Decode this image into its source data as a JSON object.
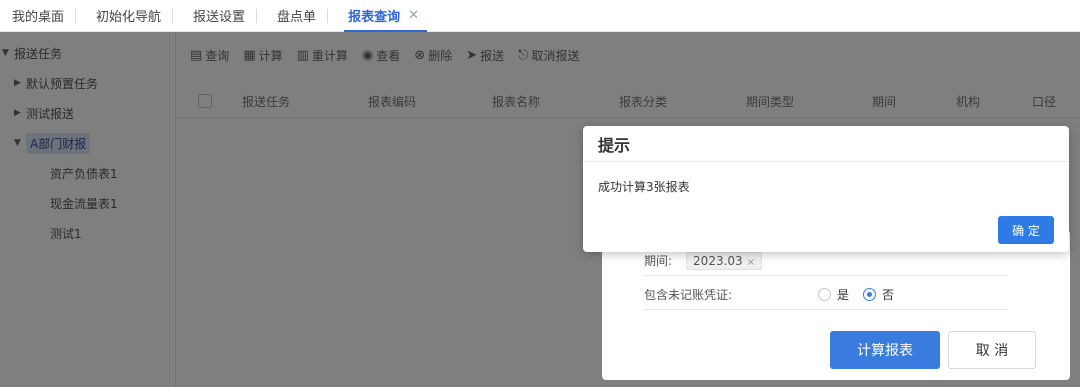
{
  "tabs": [
    {
      "label": "我的桌面"
    },
    {
      "label": "初始化导航"
    },
    {
      "label": "报送设置"
    },
    {
      "label": "盘点单"
    },
    {
      "label": "报表查询",
      "active": true,
      "close": "✕"
    }
  ],
  "sidebar": {
    "items": [
      {
        "label": "报送任务",
        "arrow": "▼"
      },
      {
        "label": "默认预置任务",
        "arrow": "▶"
      },
      {
        "label": "测试报送",
        "arrow": "▶"
      },
      {
        "label": "A部门财报",
        "arrow": "▼"
      },
      {
        "label": "资产负债表1"
      },
      {
        "label": "现金流量表1"
      },
      {
        "label": "测试1"
      }
    ]
  },
  "toolbar": {
    "query": "查询",
    "calc": "计算",
    "recalc": "重计算",
    "view": "查看",
    "delete": "删除",
    "submit": "报送",
    "cancel_submit": "取消报送"
  },
  "table": {
    "columns": [
      "报送任务",
      "报表编码",
      "报表名称",
      "报表分类",
      "期间类型",
      "期间",
      "机构",
      "口径"
    ]
  },
  "calc_dialog": {
    "period_label": "期间:",
    "period_value": "2023.03",
    "period_remove": "×",
    "include_label": "包含未记账凭证:",
    "yes": "是",
    "no": "否",
    "include_value": "否",
    "confirm_label": "计算报表",
    "cancel_label": "取 消"
  },
  "alert": {
    "title": "提示",
    "message": "成功计算3张报表",
    "ok_label": "确 定"
  },
  "colors": {
    "accent": "#2f66d6",
    "primary_button": "#2e7be6"
  }
}
